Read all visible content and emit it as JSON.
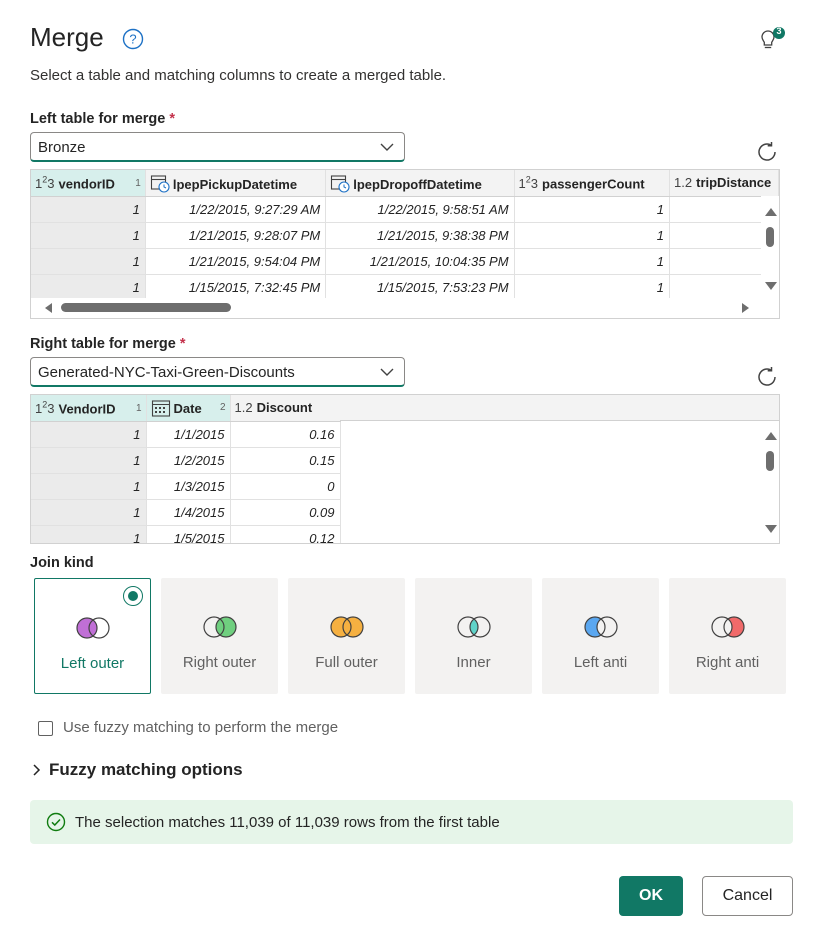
{
  "dialog": {
    "title": "Merge",
    "subtitle": "Select a table and matching columns to create a merged table.",
    "lightbulb_badge": "3"
  },
  "left": {
    "label": "Left table for merge",
    "required_mark": "*",
    "selected": "Bronze",
    "columns": [
      {
        "type": "1²3",
        "name": "vendorID",
        "index": "1",
        "key": true
      },
      {
        "type": "datetime",
        "name": "lpepPickupDatetime",
        "index": "",
        "key": false
      },
      {
        "type": "datetime",
        "name": "lpepDropoffDatetime",
        "index": "",
        "key": false
      },
      {
        "type": "1²3",
        "name": "passengerCount",
        "index": "",
        "key": false
      },
      {
        "type": "1.2",
        "name": "tripDistance",
        "index": "",
        "key": false
      }
    ],
    "rows": [
      [
        "1",
        "1/22/2015, 9:27:29 AM",
        "1/22/2015, 9:58:51 AM",
        "1",
        ""
      ],
      [
        "1",
        "1/21/2015, 9:28:07 PM",
        "1/21/2015, 9:38:38 PM",
        "1",
        ""
      ],
      [
        "1",
        "1/21/2015, 9:54:04 PM",
        "1/21/2015, 10:04:35 PM",
        "1",
        ""
      ],
      [
        "1",
        "1/15/2015, 7:32:45 PM",
        "1/15/2015, 7:53:23 PM",
        "1",
        ""
      ]
    ]
  },
  "right": {
    "label": "Right table for merge",
    "required_mark": "*",
    "selected": "Generated-NYC-Taxi-Green-Discounts",
    "columns": [
      {
        "type": "1²3",
        "name": "VendorID",
        "index": "1",
        "key": true
      },
      {
        "type": "date",
        "name": "Date",
        "index": "2",
        "key": true
      },
      {
        "type": "1.2",
        "name": "Discount",
        "index": "",
        "key": false
      }
    ],
    "rows": [
      [
        "1",
        "1/1/2015",
        "0.16"
      ],
      [
        "1",
        "1/2/2015",
        "0.15"
      ],
      [
        "1",
        "1/3/2015",
        "0"
      ],
      [
        "1",
        "1/4/2015",
        "0.09"
      ],
      [
        "1",
        "1/5/2015",
        "0.12"
      ]
    ]
  },
  "join": {
    "label": "Join kind",
    "options": [
      {
        "label": "Left outer",
        "selected": true
      },
      {
        "label": "Right outer",
        "selected": false
      },
      {
        "label": "Full outer",
        "selected": false
      },
      {
        "label": "Inner",
        "selected": false
      },
      {
        "label": "Left anti",
        "selected": false
      },
      {
        "label": "Right anti",
        "selected": false
      }
    ]
  },
  "fuzzy": {
    "checkbox_label": "Use fuzzy matching to perform the merge",
    "checked": false,
    "options_label": "Fuzzy matching options"
  },
  "status": {
    "message": "The selection matches 11,039 of 11,039 rows from the first table"
  },
  "buttons": {
    "ok": "OK",
    "cancel": "Cancel"
  },
  "colors": {
    "accent": "#117865",
    "key_header": "#d7efec",
    "success_bg": "#e6f5e9",
    "venn_purple": "#c06fd6",
    "venn_green": "#6fcf7f",
    "venn_orange": "#f5b041",
    "venn_teal": "#5fd3c9",
    "venn_blue": "#5aa7f0",
    "venn_red": "#f06a6a"
  }
}
